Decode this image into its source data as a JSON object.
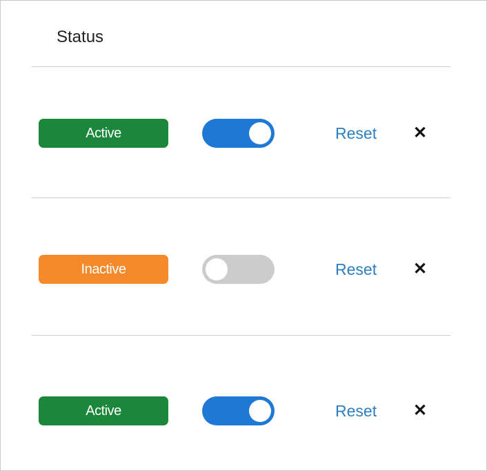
{
  "header": {
    "title": "Status"
  },
  "colors": {
    "active": "#1b873a",
    "inactive": "#f6892a",
    "toggle_on": "#1e78d6",
    "toggle_off": "#cccccc",
    "link": "#2a7fc0"
  },
  "rows": [
    {
      "status": "Active",
      "toggle_on": true,
      "reset_label": "Reset",
      "close_icon": "close-icon",
      "close_glyph": "✕"
    },
    {
      "status": "Inactive",
      "toggle_on": false,
      "reset_label": "Reset",
      "close_icon": "close-icon",
      "close_glyph": "✕"
    },
    {
      "status": "Active",
      "toggle_on": true,
      "reset_label": "Reset",
      "close_icon": "close-icon",
      "close_glyph": "✕"
    }
  ]
}
